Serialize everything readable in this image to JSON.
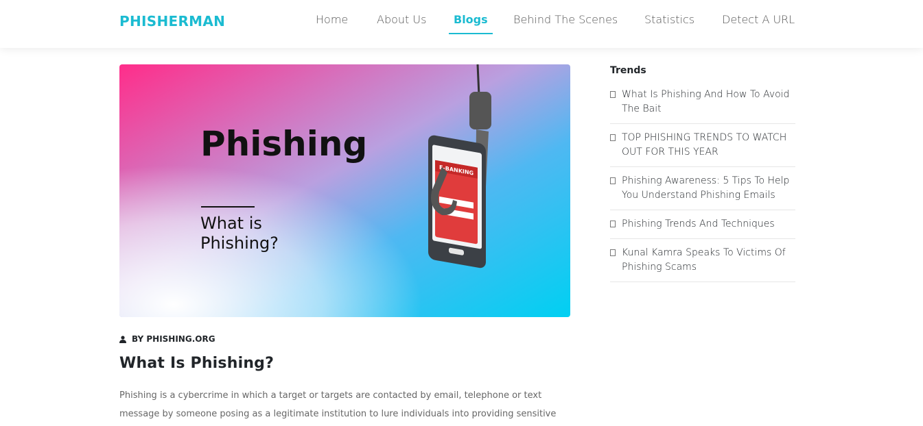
{
  "header": {
    "logo": "PHISHERMAN",
    "nav": [
      {
        "label": "Home",
        "active": false
      },
      {
        "label": "About Us",
        "active": false
      },
      {
        "label": "Blogs",
        "active": true
      },
      {
        "label": "Behind The Scenes",
        "active": false
      },
      {
        "label": "Statistics",
        "active": false
      },
      {
        "label": "Detect A URL",
        "active": false
      }
    ]
  },
  "hero": {
    "title": "Phishing",
    "subtitle_line1": "What is",
    "subtitle_line2": "Phishing?",
    "phone_label": "E-BANKING",
    "gradient_colors": [
      "#ff2d8a",
      "#5b9cf0",
      "#00c8f0"
    ]
  },
  "article": {
    "author_icon": "user-icon",
    "author": "BY PHISHING.ORG",
    "title": "What Is Phishing?",
    "body": "Phishing is a cybercrime in which a target or targets are contacted by email, telephone or text message by someone posing as a legitimate institution to lure individuals into providing sensitive data such as"
  },
  "sidebar": {
    "heading": "Trends",
    "items": [
      {
        "label": "What Is Phishing And How To Avoid The Bait"
      },
      {
        "label": "TOP PHISHING TRENDS TO WATCH OUT FOR THIS YEAR"
      },
      {
        "label": "Phishing Awareness: 5 Tips To Help You Understand Phishing Emails"
      },
      {
        "label": "Phishing Trends And Techniques"
      },
      {
        "label": "Kunal Kamra Speaks To Victims Of Phishing Scams"
      }
    ]
  },
  "colors": {
    "accent": "#1bbbd1",
    "text": "#212529",
    "muted": "#666666"
  }
}
